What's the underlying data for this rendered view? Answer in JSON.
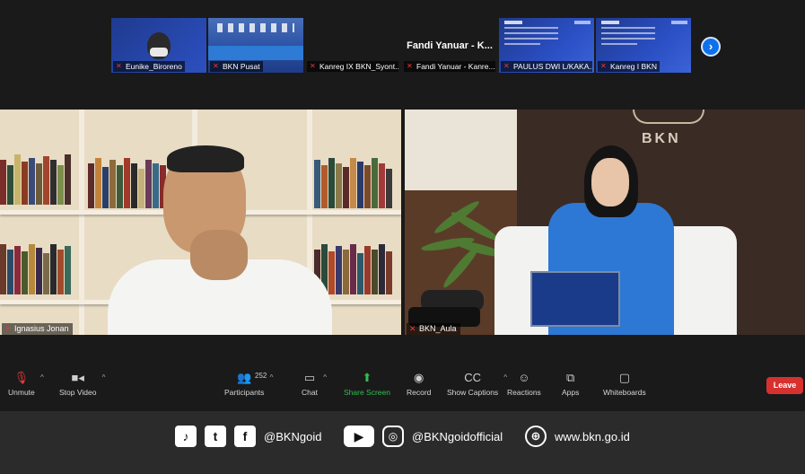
{
  "thumbnails": [
    {
      "label": "Eunike_Biroreno",
      "kind": "face"
    },
    {
      "label": "BKN Pusat",
      "kind": "hall"
    },
    {
      "label": "Kanreg IX BKN_Syont...",
      "kind": "blank"
    },
    {
      "label": "Fandi Yanuar - Kanre...",
      "kind": "name",
      "display_name": "Fandi Yanuar - K..."
    },
    {
      "label": "PAULUS DWI L/KAKA...",
      "kind": "slide"
    },
    {
      "label": "Kanreg I BKN",
      "kind": "slide"
    }
  ],
  "videos": {
    "left_label": "Ignasius Jonan",
    "right_label": "BKN_Aula",
    "right_wall_text": "BKN"
  },
  "toolbar": {
    "unmute": "Unmute",
    "stop_video": "Stop Video",
    "participants": "Participants",
    "participants_count": "252",
    "chat": "Chat",
    "share_screen": "Share Screen",
    "record": "Record",
    "show_captions": "Show Captions",
    "reactions": "Reactions",
    "apps": "Apps",
    "whiteboards": "Whiteboards",
    "leave": "Leave"
  },
  "footer": {
    "handle": "@BKNgoid",
    "youtube_handle": "@BKNgoidofficial",
    "website": "www.bkn.go.id"
  },
  "colors": {
    "share_green": "#2fbf52",
    "leave_red": "#d6312f",
    "accent_blue": "#0e71eb"
  }
}
